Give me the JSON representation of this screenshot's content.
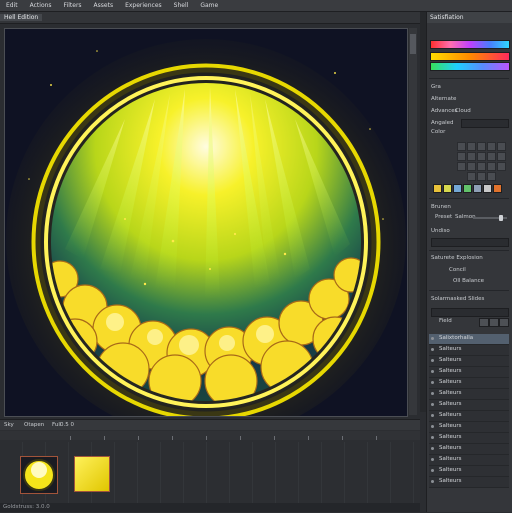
{
  "menu": [
    "Edit",
    "Actions",
    "Filters",
    "Assets",
    "Experiences",
    "Shell",
    "Game"
  ],
  "tab": {
    "title": "Hell Edition"
  },
  "panel": {
    "title": "Satisfiation",
    "labels": {
      "sec1": "Gra",
      "sec2": "Alternate",
      "mode_a": "Advances",
      "mode_b": "Cloud",
      "channel": "Angaled",
      "color_label": "Color",
      "sec3": "Brunen",
      "blend": "Preset",
      "blend_val": "Salmon",
      "ops": "Undiso",
      "props_title": "Saturete Explosion",
      "prop_val": "Concil",
      "prop_b": "Oll Balance",
      "layers_title": "Solarmasked Slides",
      "field": "Field"
    },
    "swatch_colors": [
      "#e9c23a",
      "#d6d84e",
      "#74a8d6",
      "#62c26a",
      "#8fa0b6",
      "#c9c9c9",
      "#e1732d"
    ],
    "layers": [
      "Salixtorhalla",
      "Salteurs",
      "Salteurs",
      "Salteurs",
      "Salteurs",
      "Salteurs",
      "Salteurs",
      "Salteurs",
      "Salteurs",
      "Salteurs",
      "Salteurs",
      "Salteurs",
      "Salteurs",
      "Salteurs"
    ]
  },
  "timeline": {
    "tabs": [
      "Sky",
      "Otapen",
      "Fuli"
    ],
    "controls": "0.5 0"
  },
  "status": {
    "text": "Goldstruss: 3.0.0"
  },
  "colors": {
    "accent": "#ffe600",
    "background": "#0f1223",
    "ring": "#f2e300"
  }
}
